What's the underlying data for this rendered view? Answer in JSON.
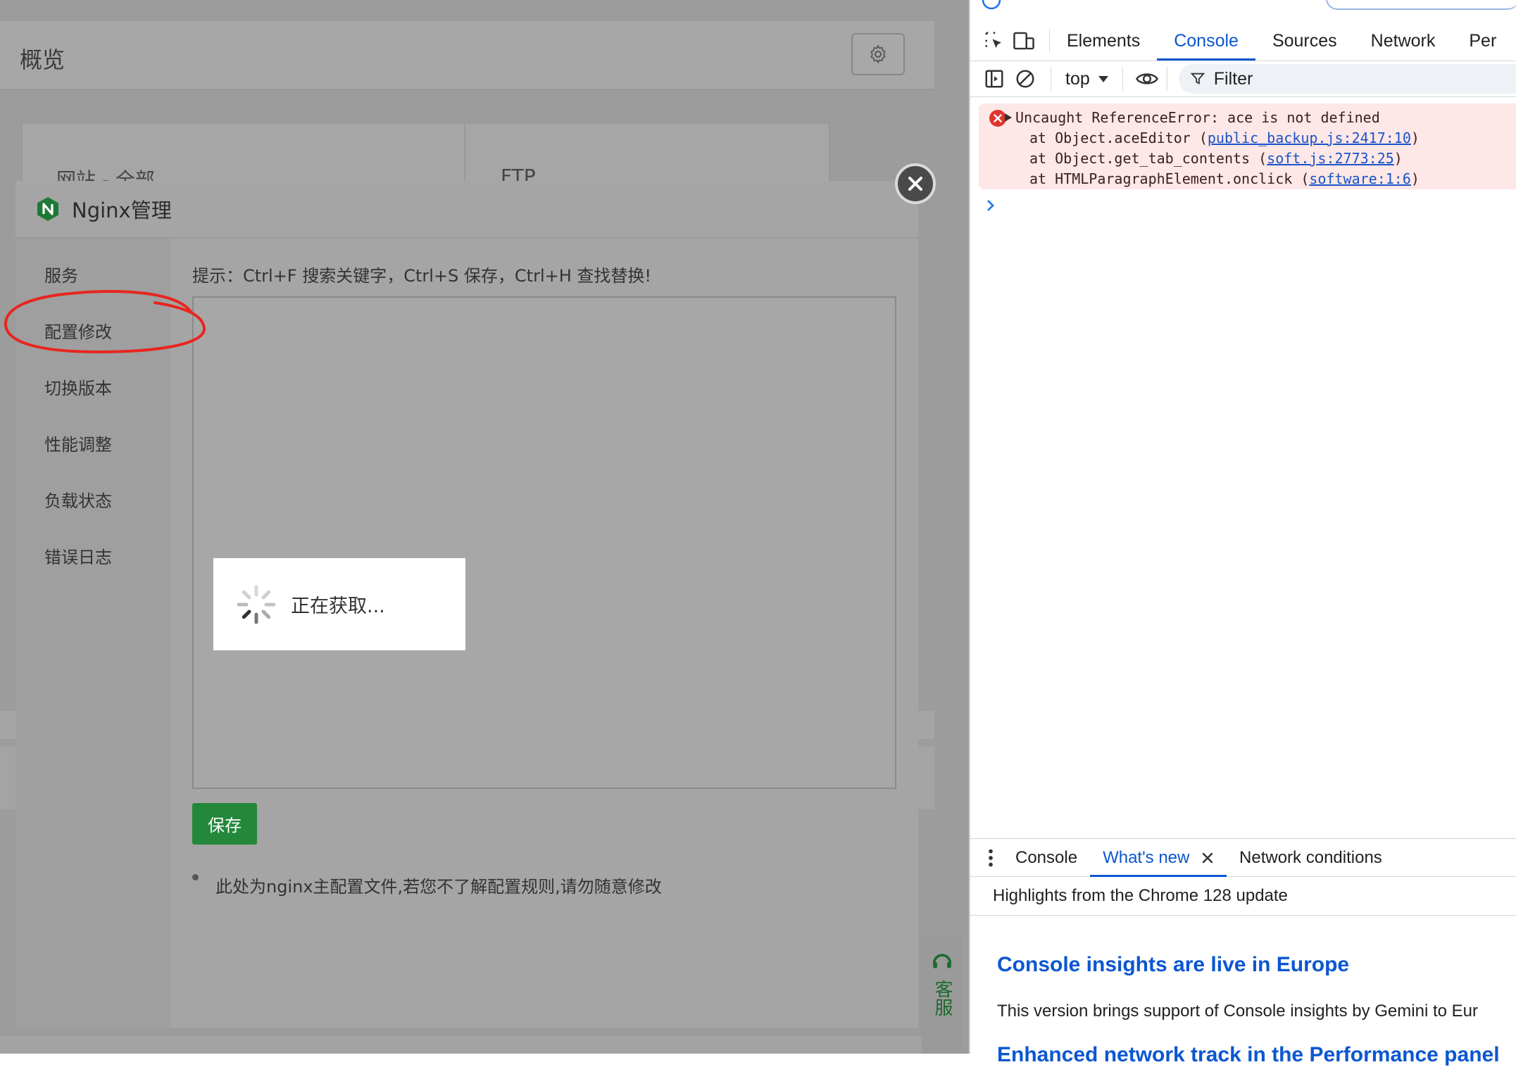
{
  "page": {
    "title": "概览",
    "card_labels": [
      "网站 - 全部",
      "FTP"
    ],
    "kefu_label": "客服"
  },
  "dialog": {
    "title": "Nginx管理",
    "sidebar": [
      {
        "label": "服务"
      },
      {
        "label": "配置修改"
      },
      {
        "label": "切换版本"
      },
      {
        "label": "性能调整"
      },
      {
        "label": "负载状态"
      },
      {
        "label": "错误日志"
      }
    ],
    "hint": "提示：Ctrl+F 搜索关键字，Ctrl+S 保存，Ctrl+H 查找替换!",
    "loading_text": "正在获取...",
    "save_label": "保存",
    "note": "此处为nginx主配置文件,若您不了解配置规则,请勿随意修改"
  },
  "devtools": {
    "tabs": [
      "Elements",
      "Console",
      "Sources",
      "Network",
      "Per"
    ],
    "active_tab": "Console",
    "context": "top",
    "filter_placeholder": "Filter",
    "error": {
      "message": "Uncaught ReferenceError: ace is not defined",
      "stack": [
        {
          "prefix": "at Object.aceEditor (",
          "link": "public_backup.js:2417:10",
          "suffix": ")"
        },
        {
          "prefix": "at Object.get_tab_contents (",
          "link": "soft.js:2773:25",
          "suffix": ")"
        },
        {
          "prefix": "at HTMLParagraphElement.onclick (",
          "link": "software:1:6",
          "suffix": ")"
        }
      ]
    },
    "drawer": {
      "tabs": [
        "Console",
        "What's new",
        "Network conditions"
      ],
      "active_tab": "What's new",
      "subtitle": "Highlights from the Chrome 128 update",
      "headline": "Console insights are live in Europe",
      "body": "This version brings support of Console insights by Gemini to Eur",
      "next_headline": "Enhanced network track in the Performance panel"
    }
  },
  "colors": {
    "overlay": "#9c9c9c",
    "save_button": "#23883a",
    "devtools_accent": "#0b57d0",
    "error_bg": "#fde7e7",
    "annotation_red": "#e8251f"
  }
}
